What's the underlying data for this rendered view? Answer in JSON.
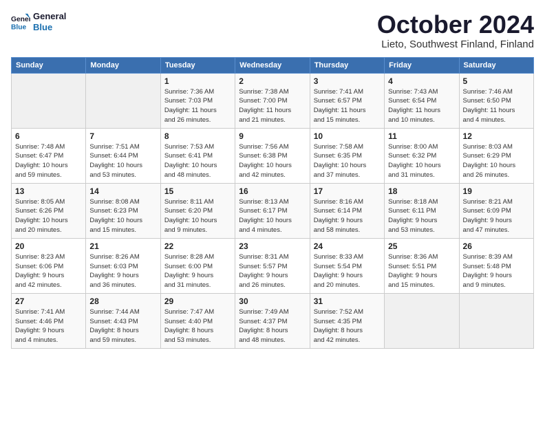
{
  "logo": {
    "line1": "General",
    "line2": "Blue"
  },
  "title": "October 2024",
  "location": "Lieto, Southwest Finland, Finland",
  "days_of_week": [
    "Sunday",
    "Monday",
    "Tuesday",
    "Wednesday",
    "Thursday",
    "Friday",
    "Saturday"
  ],
  "weeks": [
    [
      {
        "day": "",
        "info": ""
      },
      {
        "day": "",
        "info": ""
      },
      {
        "day": "1",
        "info": "Sunrise: 7:36 AM\nSunset: 7:03 PM\nDaylight: 11 hours\nand 26 minutes."
      },
      {
        "day": "2",
        "info": "Sunrise: 7:38 AM\nSunset: 7:00 PM\nDaylight: 11 hours\nand 21 minutes."
      },
      {
        "day": "3",
        "info": "Sunrise: 7:41 AM\nSunset: 6:57 PM\nDaylight: 11 hours\nand 15 minutes."
      },
      {
        "day": "4",
        "info": "Sunrise: 7:43 AM\nSunset: 6:54 PM\nDaylight: 11 hours\nand 10 minutes."
      },
      {
        "day": "5",
        "info": "Sunrise: 7:46 AM\nSunset: 6:50 PM\nDaylight: 11 hours\nand 4 minutes."
      }
    ],
    [
      {
        "day": "6",
        "info": "Sunrise: 7:48 AM\nSunset: 6:47 PM\nDaylight: 10 hours\nand 59 minutes."
      },
      {
        "day": "7",
        "info": "Sunrise: 7:51 AM\nSunset: 6:44 PM\nDaylight: 10 hours\nand 53 minutes."
      },
      {
        "day": "8",
        "info": "Sunrise: 7:53 AM\nSunset: 6:41 PM\nDaylight: 10 hours\nand 48 minutes."
      },
      {
        "day": "9",
        "info": "Sunrise: 7:56 AM\nSunset: 6:38 PM\nDaylight: 10 hours\nand 42 minutes."
      },
      {
        "day": "10",
        "info": "Sunrise: 7:58 AM\nSunset: 6:35 PM\nDaylight: 10 hours\nand 37 minutes."
      },
      {
        "day": "11",
        "info": "Sunrise: 8:00 AM\nSunset: 6:32 PM\nDaylight: 10 hours\nand 31 minutes."
      },
      {
        "day": "12",
        "info": "Sunrise: 8:03 AM\nSunset: 6:29 PM\nDaylight: 10 hours\nand 26 minutes."
      }
    ],
    [
      {
        "day": "13",
        "info": "Sunrise: 8:05 AM\nSunset: 6:26 PM\nDaylight: 10 hours\nand 20 minutes."
      },
      {
        "day": "14",
        "info": "Sunrise: 8:08 AM\nSunset: 6:23 PM\nDaylight: 10 hours\nand 15 minutes."
      },
      {
        "day": "15",
        "info": "Sunrise: 8:11 AM\nSunset: 6:20 PM\nDaylight: 10 hours\nand 9 minutes."
      },
      {
        "day": "16",
        "info": "Sunrise: 8:13 AM\nSunset: 6:17 PM\nDaylight: 10 hours\nand 4 minutes."
      },
      {
        "day": "17",
        "info": "Sunrise: 8:16 AM\nSunset: 6:14 PM\nDaylight: 9 hours\nand 58 minutes."
      },
      {
        "day": "18",
        "info": "Sunrise: 8:18 AM\nSunset: 6:11 PM\nDaylight: 9 hours\nand 53 minutes."
      },
      {
        "day": "19",
        "info": "Sunrise: 8:21 AM\nSunset: 6:09 PM\nDaylight: 9 hours\nand 47 minutes."
      }
    ],
    [
      {
        "day": "20",
        "info": "Sunrise: 8:23 AM\nSunset: 6:06 PM\nDaylight: 9 hours\nand 42 minutes."
      },
      {
        "day": "21",
        "info": "Sunrise: 8:26 AM\nSunset: 6:03 PM\nDaylight: 9 hours\nand 36 minutes."
      },
      {
        "day": "22",
        "info": "Sunrise: 8:28 AM\nSunset: 6:00 PM\nDaylight: 9 hours\nand 31 minutes."
      },
      {
        "day": "23",
        "info": "Sunrise: 8:31 AM\nSunset: 5:57 PM\nDaylight: 9 hours\nand 26 minutes."
      },
      {
        "day": "24",
        "info": "Sunrise: 8:33 AM\nSunset: 5:54 PM\nDaylight: 9 hours\nand 20 minutes."
      },
      {
        "day": "25",
        "info": "Sunrise: 8:36 AM\nSunset: 5:51 PM\nDaylight: 9 hours\nand 15 minutes."
      },
      {
        "day": "26",
        "info": "Sunrise: 8:39 AM\nSunset: 5:48 PM\nDaylight: 9 hours\nand 9 minutes."
      }
    ],
    [
      {
        "day": "27",
        "info": "Sunrise: 7:41 AM\nSunset: 4:46 PM\nDaylight: 9 hours\nand 4 minutes."
      },
      {
        "day": "28",
        "info": "Sunrise: 7:44 AM\nSunset: 4:43 PM\nDaylight: 8 hours\nand 59 minutes."
      },
      {
        "day": "29",
        "info": "Sunrise: 7:47 AM\nSunset: 4:40 PM\nDaylight: 8 hours\nand 53 minutes."
      },
      {
        "day": "30",
        "info": "Sunrise: 7:49 AM\nSunset: 4:37 PM\nDaylight: 8 hours\nand 48 minutes."
      },
      {
        "day": "31",
        "info": "Sunrise: 7:52 AM\nSunset: 4:35 PM\nDaylight: 8 hours\nand 42 minutes."
      },
      {
        "day": "",
        "info": ""
      },
      {
        "day": "",
        "info": ""
      }
    ]
  ]
}
